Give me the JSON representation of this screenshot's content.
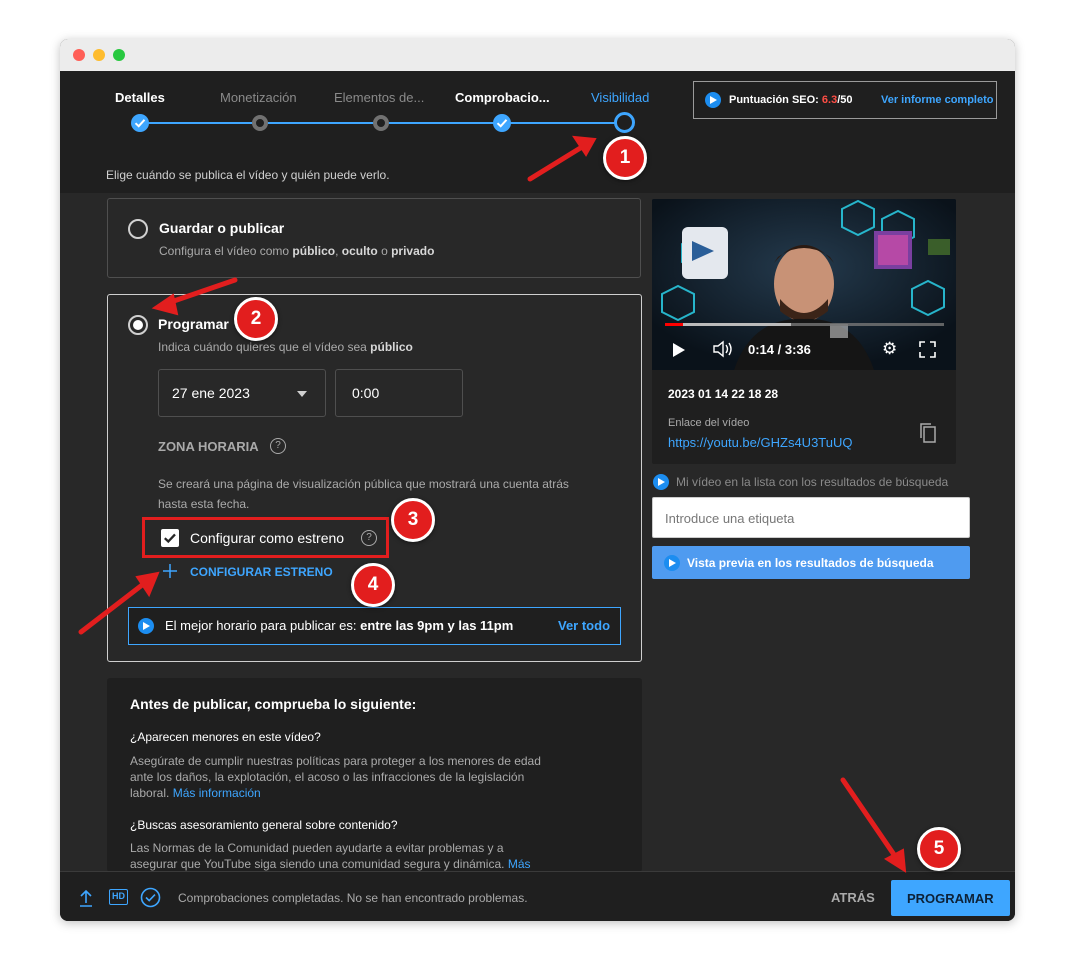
{
  "stepper": {
    "steps": [
      {
        "label": "Detalles",
        "state": "done"
      },
      {
        "label": "Monetización",
        "state": "pending"
      },
      {
        "label": "Elementos de...",
        "state": "pending"
      },
      {
        "label": "Comprobacio...",
        "state": "done"
      },
      {
        "label": "Visibilidad",
        "state": "active"
      }
    ]
  },
  "seo": {
    "label": "Puntuación SEO:",
    "score": "6.3",
    "max": "/50",
    "report_link": "Ver informe completo"
  },
  "intro": "Elige cuándo se publica el vídeo y quién puede verlo.",
  "save_publish": {
    "title": "Guardar o publicar",
    "desc_parts": [
      "Configura el vídeo como ",
      "público",
      ", ",
      "oculto",
      " o ",
      "privado"
    ]
  },
  "schedule": {
    "title": "Programar",
    "desc_parts": [
      "Indica cuándo quieres que el vídeo sea ",
      "público"
    ],
    "date": "27 ene 2023",
    "time": "0:00",
    "timezone_label": "ZONA HORARIA",
    "info_line1": "Se creará una página de visualización pública que mostrará una cuenta atrás",
    "info_line2": "hasta esta fecha.",
    "premiere_checkbox": "Configurar como estreno",
    "premiere_checked": true,
    "configure_premiere": "CONFIGURAR ESTRENO",
    "best_time_prefix": "El mejor horario para publicar es: ",
    "best_time_value": "entre las 9pm y las 11pm",
    "best_time_link": "Ver todo"
  },
  "checklist": {
    "title": "Antes de publicar, comprueba lo siguiente:",
    "q1": "¿Aparecen menores en este vídeo?",
    "q1_lines": [
      "Asegúrate de cumplir nuestras políticas para proteger a los menores de edad",
      "ante los daños, la explotación, el acoso o las infracciones de la legislación",
      "laboral."
    ],
    "q1_link": "Más información",
    "q2": "¿Buscas asesoramiento general sobre contenido?",
    "q2_lines": [
      "Las Normas de la Comunidad pueden ayudarte a evitar problemas y a",
      "asegurar que YouTube siga siendo una comunidad segura y dinámica."
    ],
    "q2_link": "Más"
  },
  "video": {
    "time_display": "0:14 / 3:36",
    "progress_fraction": 0.065,
    "buffered_fraction": 0.45,
    "title": "2023 01 14 22 18 28",
    "link_label": "Enlace del vídeo",
    "link_url": "https://youtu.be/GHZs4U3TuUQ"
  },
  "search_panel": {
    "label": "Mi vídeo en la lista con los resultados de búsqueda",
    "input_placeholder": "Introduce una etiqueta",
    "preview_button": "Vista previa en los resultados de búsqueda"
  },
  "footer": {
    "status": "Comprobaciones completadas. No se han encontrado problemas.",
    "back_button": "ATRÁS",
    "primary_button": "PROGRAMAR"
  },
  "annotations": [
    "1",
    "2",
    "3",
    "4",
    "5"
  ],
  "colors": {
    "accent": "#3ea6ff",
    "highlight_red": "#e21e1e",
    "background": "#282828",
    "score_red": "#ff4e45"
  }
}
